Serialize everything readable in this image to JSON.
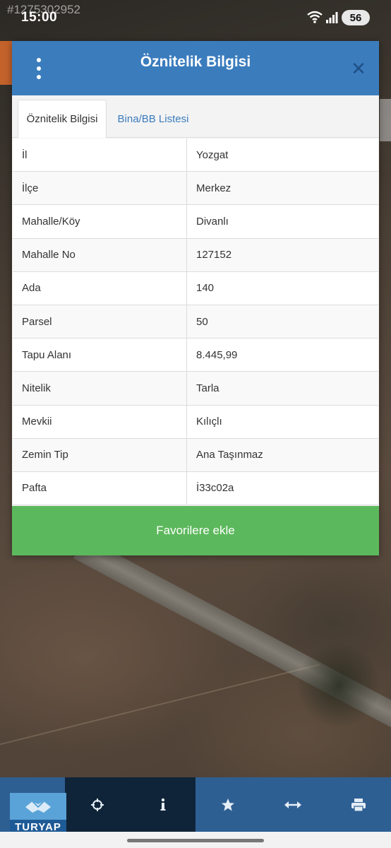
{
  "status_bar": {
    "time": "15:00",
    "battery": "56",
    "watermark_id": "#1275302952"
  },
  "dialog": {
    "title": "Öznitelik Bilgisi",
    "tabs": [
      {
        "label": "Öznitelik Bilgisi",
        "active": true
      },
      {
        "label": "Bina/BB Listesi",
        "active": false
      }
    ],
    "rows": [
      {
        "key": "İl",
        "value": "Yozgat"
      },
      {
        "key": "İlçe",
        "value": "Merkez"
      },
      {
        "key": "Mahalle/Köy",
        "value": "Divanlı"
      },
      {
        "key": "Mahalle No",
        "value": "127152"
      },
      {
        "key": "Ada",
        "value": "140"
      },
      {
        "key": "Parsel",
        "value": "50"
      },
      {
        "key": "Tapu Alanı",
        "value": "8.445,99"
      },
      {
        "key": "Nitelik",
        "value": "Tarla"
      },
      {
        "key": "Mevkii",
        "value": "Kılıçlı"
      },
      {
        "key": "Zemin Tip",
        "value": "Ana Taşınmaz"
      },
      {
        "key": "Pafta",
        "value": "İ33c02a"
      }
    ],
    "favorite_label": "Favorilere ekle"
  },
  "toolbar": {
    "items": [
      {
        "icon": "layers-icon"
      },
      {
        "icon": "crosshair-icon"
      },
      {
        "icon": "info-icon"
      },
      {
        "icon": "star-icon"
      },
      {
        "icon": "measure-icon"
      },
      {
        "icon": "print-icon"
      }
    ]
  },
  "logo": {
    "text": "TURYAP"
  },
  "colors": {
    "header": "#3b7cbd",
    "favorite": "#5cb85c",
    "toolbar": "#2e5f93"
  }
}
